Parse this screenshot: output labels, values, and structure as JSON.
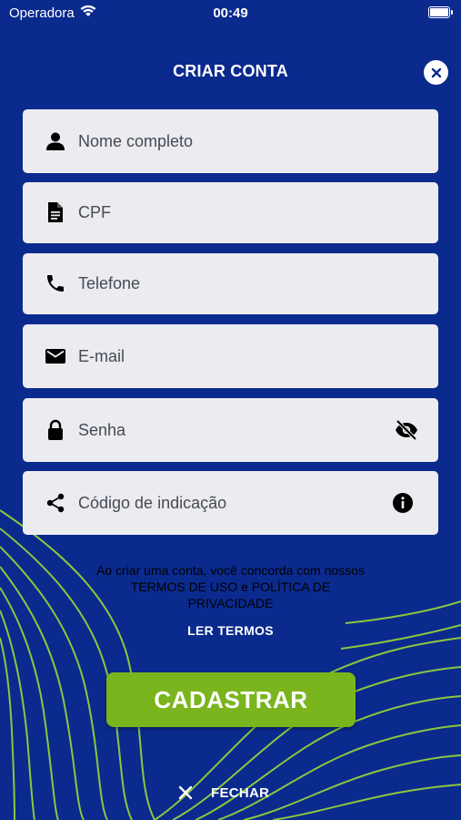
{
  "colors": {
    "background": "#0b2a8e",
    "accent_green": "#7ab51d",
    "field_bg": "#ececf0",
    "wave": "#8cc63f"
  },
  "status_bar": {
    "carrier": "Operadora",
    "time": "00:49"
  },
  "header": {
    "title": "CRIAR CONTA"
  },
  "fields": [
    {
      "icon": "person-icon",
      "placeholder": "Nome completo"
    },
    {
      "icon": "document-icon",
      "placeholder": "CPF"
    },
    {
      "icon": "phone-icon",
      "placeholder": "Telefone"
    },
    {
      "icon": "mail-icon",
      "placeholder": "E-mail"
    },
    {
      "icon": "lock-icon",
      "placeholder": "Senha",
      "trailing_icon": "eye-off-icon"
    },
    {
      "icon": "share-icon",
      "placeholder": "Código de indicação",
      "trailing_icon": "info-icon"
    }
  ],
  "terms": {
    "text": "Ao criar uma conta, você concorda com nossos TERMOS DE USO e POLÍTICA DE PRIVACIDADE",
    "link": "LER TERMOS"
  },
  "submit_label": "CADASTRAR",
  "close_label": "FECHAR"
}
